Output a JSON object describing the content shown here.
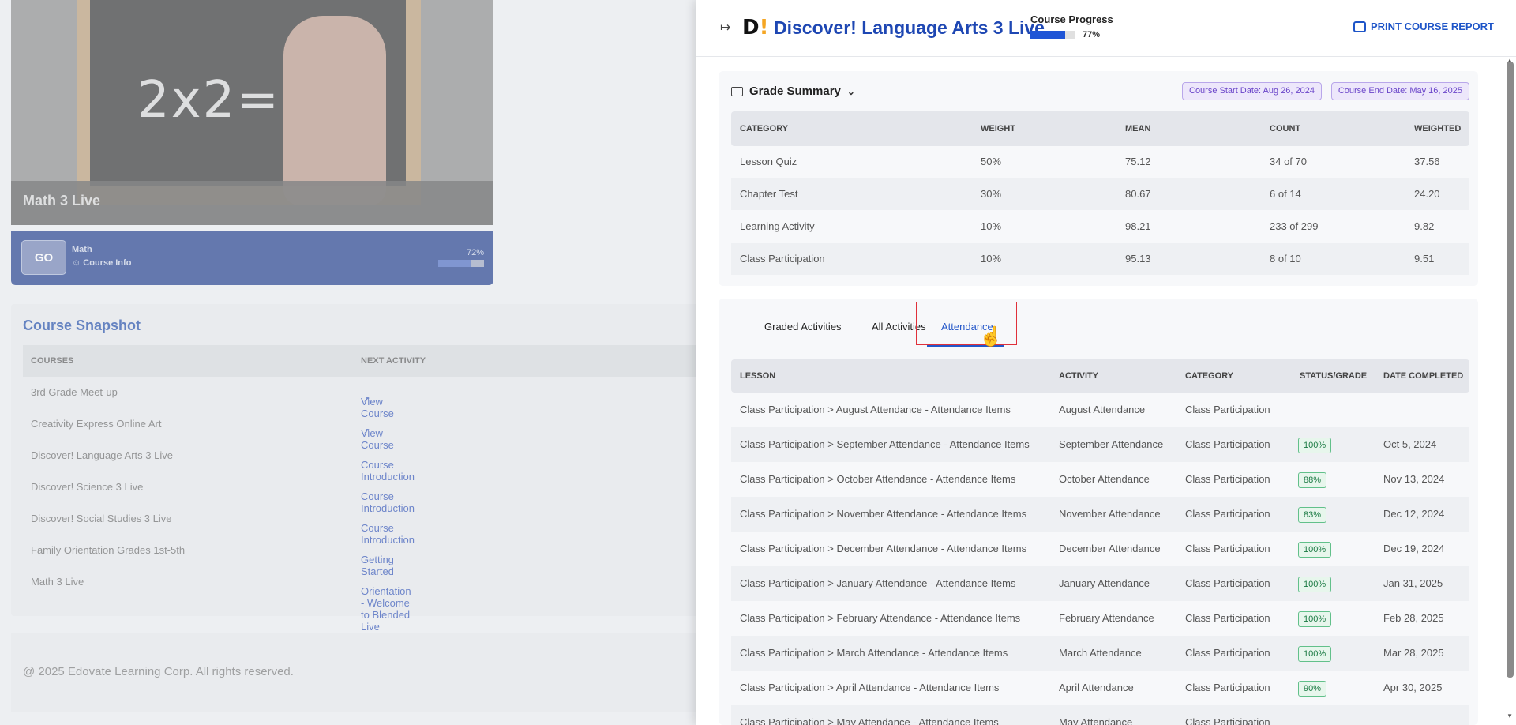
{
  "background": {
    "card": {
      "chalk_text": "2x2=",
      "title": "Math 3 Live",
      "go_label": "GO",
      "subject": "Math",
      "course_info": "Course Info",
      "progress_pct": "72%",
      "progress_value": 72
    },
    "snapshot": {
      "title": "Course Snapshot",
      "columns": [
        "COURSES",
        "NEXT ACTIVITY"
      ],
      "rows": [
        {
          "course": "3rd Grade Meet-up",
          "next": "View Course"
        },
        {
          "course": "Creativity Express Online Art",
          "next": "View Course"
        },
        {
          "course": "Discover! Language Arts 3 Live",
          "next": "Course Introduction"
        },
        {
          "course": "Discover! Science 3 Live",
          "next": "Course Introduction"
        },
        {
          "course": "Discover! Social Studies 3 Live",
          "next": "Course Introduction"
        },
        {
          "course": "Family Orientation Grades 1st-5th",
          "next": "Getting Started"
        },
        {
          "course": "Math 3 Live",
          "next": "Orientation - Welcome to Blended Live Elementary Math"
        }
      ]
    },
    "footer": "@ 2025 Edovate Learning Corp. All rights reserved."
  },
  "drawer": {
    "logo_letter": "D",
    "logo_mark": "!",
    "title": "Discover! Language Arts 3 Live",
    "progress_label": "Course Progress",
    "progress_pct": "77%",
    "progress_value": 77,
    "print_label": "PRINT COURSE REPORT",
    "grade_summary": {
      "title": "Grade Summary",
      "start_date": "Course Start Date: Aug 26, 2024",
      "end_date": "Course End Date: May 16, 2025",
      "columns": [
        "CATEGORY",
        "WEIGHT",
        "MEAN",
        "COUNT",
        "WEIGHTED"
      ],
      "rows": [
        {
          "category": "Lesson Quiz",
          "weight": "50%",
          "mean": "75.12",
          "count": "34 of 70",
          "weighted": "37.56"
        },
        {
          "category": "Chapter Test",
          "weight": "30%",
          "mean": "80.67",
          "count": "6 of 14",
          "weighted": "24.20"
        },
        {
          "category": "Learning Activity",
          "weight": "10%",
          "mean": "98.21",
          "count": "233 of 299",
          "weighted": "9.82"
        },
        {
          "category": "Class Participation",
          "weight": "10%",
          "mean": "95.13",
          "count": "8 of 10",
          "weighted": "9.51"
        }
      ]
    },
    "tabs": [
      "Graded Activities",
      "All Activities",
      "Attendance"
    ],
    "attendance": {
      "columns": [
        "LESSON",
        "ACTIVITY",
        "CATEGORY",
        "STATUS/GRADE",
        "DATE COMPLETED"
      ],
      "rows": [
        {
          "lesson": "Class Participation > August Attendance - Attendance Items",
          "activity": "August Attendance",
          "category": "Class Participation",
          "grade": "",
          "date": ""
        },
        {
          "lesson": "Class Participation > September Attendance - Attendance Items",
          "activity": "September Attendance",
          "category": "Class Participation",
          "grade": "100%",
          "date": "Oct 5, 2024"
        },
        {
          "lesson": "Class Participation > October Attendance - Attendance Items",
          "activity": "October Attendance",
          "category": "Class Participation",
          "grade": "88%",
          "date": "Nov 13, 2024"
        },
        {
          "lesson": "Class Participation > November Attendance - Attendance Items",
          "activity": "November Attendance",
          "category": "Class Participation",
          "grade": "83%",
          "date": "Dec 12, 2024"
        },
        {
          "lesson": "Class Participation > December Attendance - Attendance Items",
          "activity": "December Attendance",
          "category": "Class Participation",
          "grade": "100%",
          "date": "Dec 19, 2024"
        },
        {
          "lesson": "Class Participation > January Attendance - Attendance Items",
          "activity": "January Attendance",
          "category": "Class Participation",
          "grade": "100%",
          "date": "Jan 31, 2025"
        },
        {
          "lesson": "Class Participation > February Attendance - Attendance Items",
          "activity": "February Attendance",
          "category": "Class Participation",
          "grade": "100%",
          "date": "Feb 28, 2025"
        },
        {
          "lesson": "Class Participation > March Attendance - Attendance Items",
          "activity": "March Attendance",
          "category": "Class Participation",
          "grade": "100%",
          "date": "Mar 28, 2025"
        },
        {
          "lesson": "Class Participation > April Attendance - Attendance Items",
          "activity": "April Attendance",
          "category": "Class Participation",
          "grade": "90%",
          "date": "Apr 30, 2025"
        },
        {
          "lesson": "Class Participation > May Attendance - Attendance Items",
          "activity": "May Attendance",
          "category": "Class Participation",
          "grade": "",
          "date": ""
        }
      ]
    }
  },
  "colors": {
    "brand_blue": "#1e47b3",
    "accent_orange": "#f5a623",
    "badge_green": "#1b7a43",
    "highlight_red": "#e0303a"
  }
}
